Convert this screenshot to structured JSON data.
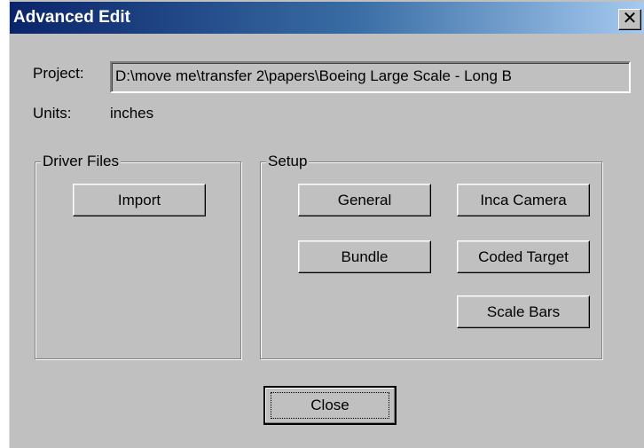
{
  "window": {
    "title": "Advanced Edit",
    "close_glyph": "✕"
  },
  "project": {
    "label": "Project:",
    "value": "D:\\move me\\transfer 2\\papers\\Boeing Large Scale - Long B"
  },
  "units": {
    "label": "Units:",
    "value": "inches"
  },
  "driver_files": {
    "legend": "Driver Files",
    "import_label": "Import"
  },
  "setup": {
    "legend": "Setup",
    "general_label": "General",
    "inca_camera_label": "Inca Camera",
    "bundle_label": "Bundle",
    "coded_target_label": "Coded Target",
    "scale_bars_label": "Scale Bars"
  },
  "footer": {
    "close_label": "Close"
  },
  "colors": {
    "dialog_face": "#c0c0c0",
    "titlebar_start": "#0a246a",
    "titlebar_end": "#a6caf0",
    "title_text": "#ffffff"
  }
}
